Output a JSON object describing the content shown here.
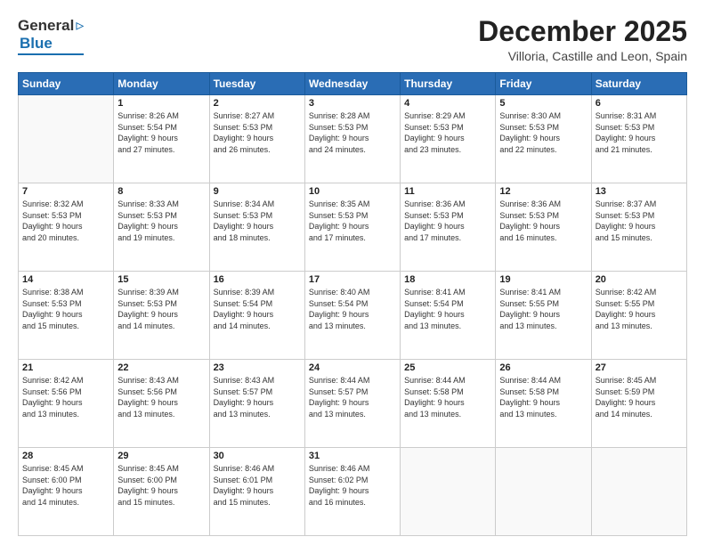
{
  "header": {
    "logo_general": "General",
    "logo_blue": "Blue",
    "month_title": "December 2025",
    "location": "Villoria, Castille and Leon, Spain"
  },
  "weekdays": [
    "Sunday",
    "Monday",
    "Tuesday",
    "Wednesday",
    "Thursday",
    "Friday",
    "Saturday"
  ],
  "weeks": [
    [
      {
        "day": "",
        "info": ""
      },
      {
        "day": "1",
        "sunrise": "8:26 AM",
        "sunset": "5:54 PM",
        "daylight": "9 hours and 27 minutes."
      },
      {
        "day": "2",
        "sunrise": "8:27 AM",
        "sunset": "5:53 PM",
        "daylight": "9 hours and 26 minutes."
      },
      {
        "day": "3",
        "sunrise": "8:28 AM",
        "sunset": "5:53 PM",
        "daylight": "9 hours and 24 minutes."
      },
      {
        "day": "4",
        "sunrise": "8:29 AM",
        "sunset": "5:53 PM",
        "daylight": "9 hours and 23 minutes."
      },
      {
        "day": "5",
        "sunrise": "8:30 AM",
        "sunset": "5:53 PM",
        "daylight": "9 hours and 22 minutes."
      },
      {
        "day": "6",
        "sunrise": "8:31 AM",
        "sunset": "5:53 PM",
        "daylight": "9 hours and 21 minutes."
      }
    ],
    [
      {
        "day": "7",
        "sunrise": "8:32 AM",
        "sunset": "5:53 PM",
        "daylight": "9 hours and 20 minutes."
      },
      {
        "day": "8",
        "sunrise": "8:33 AM",
        "sunset": "5:53 PM",
        "daylight": "9 hours and 19 minutes."
      },
      {
        "day": "9",
        "sunrise": "8:34 AM",
        "sunset": "5:53 PM",
        "daylight": "9 hours and 18 minutes."
      },
      {
        "day": "10",
        "sunrise": "8:35 AM",
        "sunset": "5:53 PM",
        "daylight": "9 hours and 17 minutes."
      },
      {
        "day": "11",
        "sunrise": "8:36 AM",
        "sunset": "5:53 PM",
        "daylight": "9 hours and 17 minutes."
      },
      {
        "day": "12",
        "sunrise": "8:36 AM",
        "sunset": "5:53 PM",
        "daylight": "9 hours and 16 minutes."
      },
      {
        "day": "13",
        "sunrise": "8:37 AM",
        "sunset": "5:53 PM",
        "daylight": "9 hours and 15 minutes."
      }
    ],
    [
      {
        "day": "14",
        "sunrise": "8:38 AM",
        "sunset": "5:53 PM",
        "daylight": "9 hours and 15 minutes."
      },
      {
        "day": "15",
        "sunrise": "8:39 AM",
        "sunset": "5:53 PM",
        "daylight": "9 hours and 14 minutes."
      },
      {
        "day": "16",
        "sunrise": "8:39 AM",
        "sunset": "5:54 PM",
        "daylight": "9 hours and 14 minutes."
      },
      {
        "day": "17",
        "sunrise": "8:40 AM",
        "sunset": "5:54 PM",
        "daylight": "9 hours and 13 minutes."
      },
      {
        "day": "18",
        "sunrise": "8:41 AM",
        "sunset": "5:54 PM",
        "daylight": "9 hours and 13 minutes."
      },
      {
        "day": "19",
        "sunrise": "8:41 AM",
        "sunset": "5:55 PM",
        "daylight": "9 hours and 13 minutes."
      },
      {
        "day": "20",
        "sunrise": "8:42 AM",
        "sunset": "5:55 PM",
        "daylight": "9 hours and 13 minutes."
      }
    ],
    [
      {
        "day": "21",
        "sunrise": "8:42 AM",
        "sunset": "5:56 PM",
        "daylight": "9 hours and 13 minutes."
      },
      {
        "day": "22",
        "sunrise": "8:43 AM",
        "sunset": "5:56 PM",
        "daylight": "9 hours and 13 minutes."
      },
      {
        "day": "23",
        "sunrise": "8:43 AM",
        "sunset": "5:57 PM",
        "daylight": "9 hours and 13 minutes."
      },
      {
        "day": "24",
        "sunrise": "8:44 AM",
        "sunset": "5:57 PM",
        "daylight": "9 hours and 13 minutes."
      },
      {
        "day": "25",
        "sunrise": "8:44 AM",
        "sunset": "5:58 PM",
        "daylight": "9 hours and 13 minutes."
      },
      {
        "day": "26",
        "sunrise": "8:44 AM",
        "sunset": "5:58 PM",
        "daylight": "9 hours and 13 minutes."
      },
      {
        "day": "27",
        "sunrise": "8:45 AM",
        "sunset": "5:59 PM",
        "daylight": "9 hours and 14 minutes."
      }
    ],
    [
      {
        "day": "28",
        "sunrise": "8:45 AM",
        "sunset": "6:00 PM",
        "daylight": "9 hours and 14 minutes."
      },
      {
        "day": "29",
        "sunrise": "8:45 AM",
        "sunset": "6:00 PM",
        "daylight": "9 hours and 15 minutes."
      },
      {
        "day": "30",
        "sunrise": "8:46 AM",
        "sunset": "6:01 PM",
        "daylight": "9 hours and 15 minutes."
      },
      {
        "day": "31",
        "sunrise": "8:46 AM",
        "sunset": "6:02 PM",
        "daylight": "9 hours and 16 minutes."
      },
      {
        "day": "",
        "info": ""
      },
      {
        "day": "",
        "info": ""
      },
      {
        "day": "",
        "info": ""
      }
    ]
  ],
  "labels": {
    "sunrise": "Sunrise:",
    "sunset": "Sunset:",
    "daylight": "Daylight:"
  }
}
